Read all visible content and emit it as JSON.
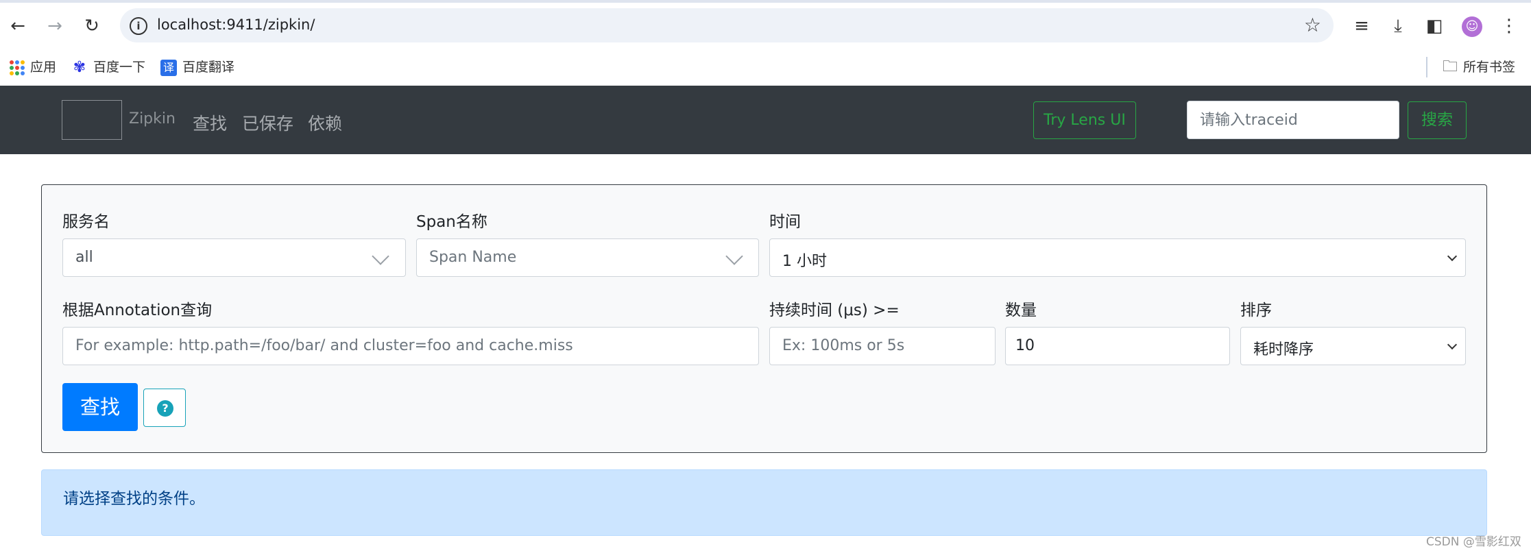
{
  "browser": {
    "url": "localhost:9411/zipkin/",
    "bookmarks": [
      {
        "label": "应用",
        "icon": "apps-grid-icon"
      },
      {
        "label": "百度一下",
        "icon": "baidu-paw-icon"
      },
      {
        "label": "百度翻译",
        "icon": "translate-icon",
        "icon_glyph": "译"
      }
    ],
    "all_bookmarks": "所有书签"
  },
  "navbar": {
    "brand": "Zipkin",
    "links": [
      "查找",
      "已保存",
      "依赖"
    ],
    "lens_button": "Try Lens UI",
    "traceid_placeholder": "请输入traceid",
    "search_button": "搜索"
  },
  "form": {
    "service_label": "服务名",
    "service_value": "all",
    "span_label": "Span名称",
    "span_placeholder": "Span Name",
    "time_label": "时间",
    "time_value": "1 小时",
    "annotation_label": "根据Annotation查询",
    "annotation_placeholder": "For example: http.path=/foo/bar/ and cluster=foo and cache.miss",
    "duration_label": "持续时间 (μs) >=",
    "duration_placeholder": "Ex: 100ms or 5s",
    "limit_label": "数量",
    "limit_value": "10",
    "sort_label": "排序",
    "sort_value": "耗时降序",
    "find_button": "查找",
    "help_icon_glyph": "?"
  },
  "alert": {
    "message": "请选择查找的条件。"
  },
  "watermark": "CSDN @雪影红双",
  "colors": {
    "navbar_bg": "#343a40",
    "primary": "#007bff",
    "success": "#28a745",
    "info": "#17a2b8",
    "alert_bg": "#cce5ff"
  }
}
